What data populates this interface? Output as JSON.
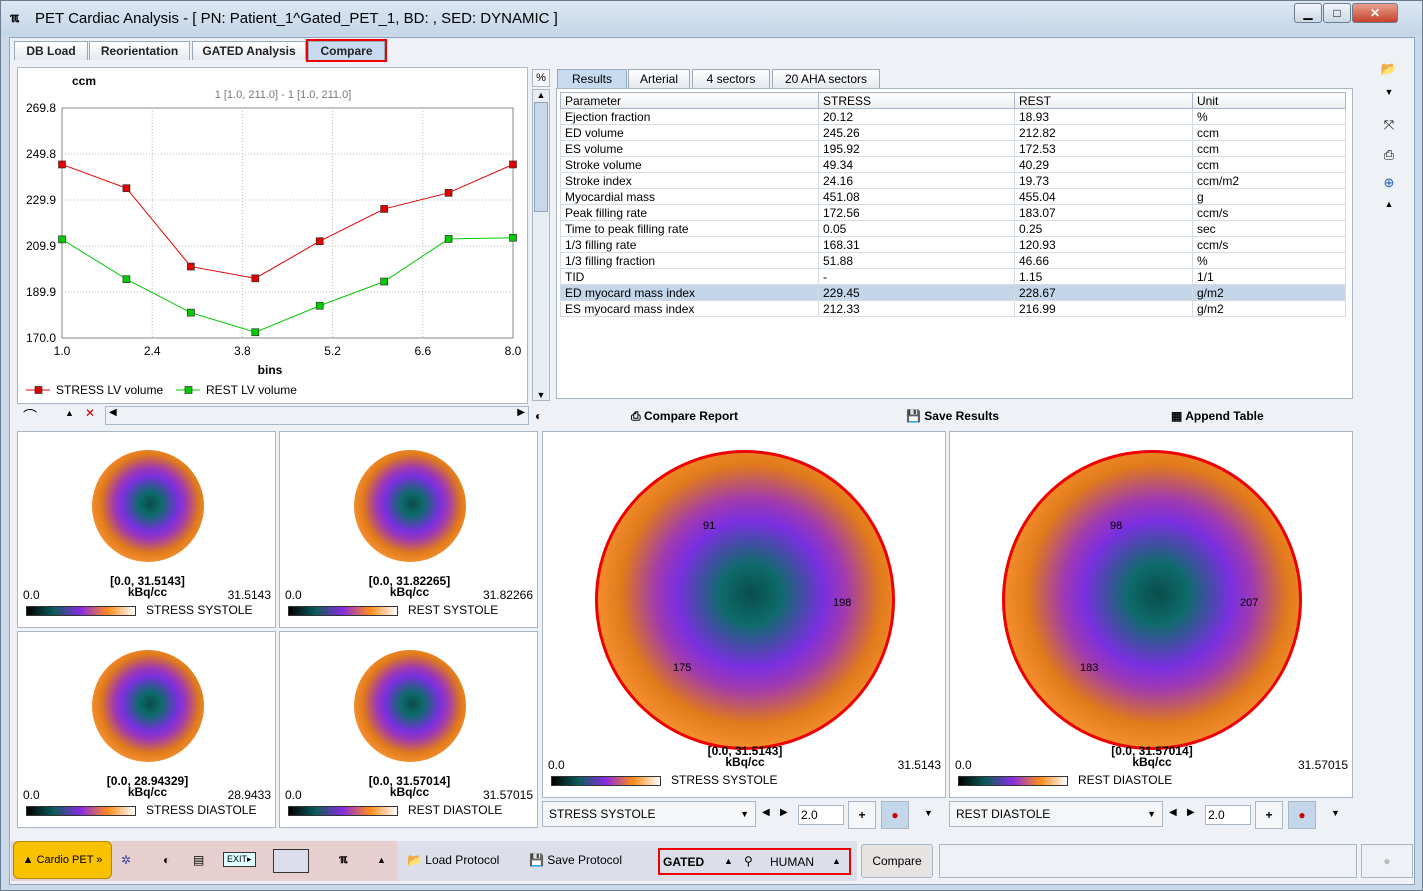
{
  "window": {
    "title": "PET Cardiac Analysis - [ PN: Patient_1^Gated_PET_1, BD: , SED: DYNAMIC ]"
  },
  "tabs": [
    {
      "label": "DB Load"
    },
    {
      "label": "Reorientation"
    },
    {
      "label": "GATED Analysis"
    },
    {
      "label": "Compare",
      "active": true
    }
  ],
  "chart": {
    "percent_btn": "%"
  },
  "chart_data": {
    "type": "line",
    "ylabel": "ccm",
    "subtitle": "1 [1.0, 211.0] - 1 [1.0, 211.0]",
    "xlabel": "bins",
    "ylim": [
      170.0,
      269.8
    ],
    "xlim": [
      1.0,
      8.0
    ],
    "yticks": [
      "170.0",
      "189.9",
      "209.9",
      "229.9",
      "249.8",
      "269.8"
    ],
    "xticks": [
      "1.0",
      "2.4",
      "3.8",
      "5.2",
      "6.6",
      "8.0"
    ],
    "grid": true,
    "legend": "bottom",
    "x": [
      1,
      2,
      3,
      4,
      5,
      6,
      7,
      8
    ],
    "series": [
      {
        "name": "STRESS LV volume",
        "color": "#e00000",
        "values": [
          245.3,
          235.0,
          201.0,
          195.9,
          212.0,
          226.0,
          233.0,
          245.3
        ]
      },
      {
        "name": "REST LV volume",
        "color": "#00cc00",
        "values": [
          212.8,
          195.5,
          181.0,
          172.5,
          184.0,
          194.5,
          213.0,
          213.5
        ]
      }
    ]
  },
  "results_tabs": [
    {
      "label": "Results",
      "active": true
    },
    {
      "label": "Arterial"
    },
    {
      "label": "4 sectors"
    },
    {
      "label": "20 AHA sectors"
    }
  ],
  "results": {
    "columns": [
      "Parameter",
      "STRESS",
      "REST",
      "Unit"
    ],
    "rows": [
      [
        "Ejection fraction",
        "20.12",
        "18.93",
        "%"
      ],
      [
        "ED volume",
        "245.26",
        "212.82",
        "ccm"
      ],
      [
        "ES volume",
        "195.92",
        "172.53",
        "ccm"
      ],
      [
        "Stroke volume",
        "49.34",
        "40.29",
        "ccm"
      ],
      [
        "Stroke index",
        "24.16",
        "19.73",
        "ccm/m2"
      ],
      [
        "Myocardial mass",
        "451.08",
        "455.04",
        "g"
      ],
      [
        "Peak filling rate",
        "172.56",
        "183.07",
        "ccm/s"
      ],
      [
        "Time to peak filling rate",
        "0.05",
        "0.25",
        "sec"
      ],
      [
        "1/3 filling rate",
        "168.31",
        "120.93",
        "ccm/s"
      ],
      [
        "1/3 filling fraction",
        "51.88",
        "46.66",
        "%"
      ],
      [
        "TID",
        "-",
        "1.15",
        "1/1"
      ],
      [
        "ED myocard mass index",
        "229.45",
        "228.67",
        "g/m2"
      ],
      [
        "ES myocard mass index",
        "212.33",
        "216.99",
        "g/m2"
      ]
    ],
    "selected_row": 11
  },
  "actions": {
    "compare_report": "Compare Report",
    "save_results": "Save Results",
    "append_table": "Append Table"
  },
  "small_maps": [
    {
      "range": "[0.0, 31.5143]",
      "unit": "kBq/cc",
      "min": "0.0",
      "max": "31.5143",
      "label": "STRESS SYSTOLE"
    },
    {
      "range": "[0.0, 31.82265]",
      "unit": "kBq/cc",
      "min": "0.0",
      "max": "31.82266",
      "label": "REST SYSTOLE"
    },
    {
      "range": "[0.0, 28.94329]",
      "unit": "kBq/cc",
      "min": "0.0",
      "max": "28.9433",
      "label": "STRESS DIASTOLE"
    },
    {
      "range": "[0.0, 31.57014]",
      "unit": "kBq/cc",
      "min": "0.0",
      "max": "31.57015",
      "label": "REST DIASTOLE"
    }
  ],
  "large_maps": [
    {
      "range": "[0.0, 31.5143]",
      "unit": "kBq/cc",
      "min": "0.0",
      "max": "31.5143",
      "label": "STRESS SYSTOLE",
      "sectors": [
        "91",
        "198",
        "175"
      ],
      "select": "STRESS SYSTOLE",
      "zoom": "2.0"
    },
    {
      "range": "[0.0, 31.57014]",
      "unit": "kBq/cc",
      "min": "0.0",
      "max": "31.57015",
      "label": "REST DIASTOLE",
      "sectors": [
        "98",
        "207",
        "183"
      ],
      "select": "REST DIASTOLE",
      "zoom": "2.0"
    }
  ],
  "bottom": {
    "cardio": "Cardio PET »",
    "load_protocol": "Load Protocol",
    "save_protocol": "Save Protocol",
    "mode": "GATED",
    "species": "HUMAN",
    "compare": "Compare"
  }
}
